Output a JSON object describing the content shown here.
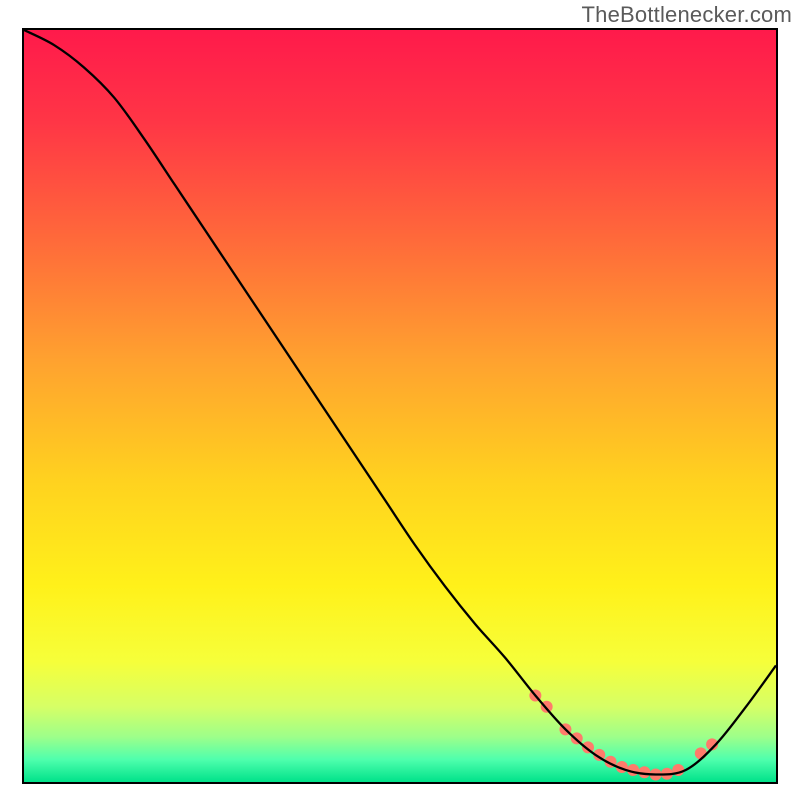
{
  "watermark": "TheBottlenecker.com",
  "chart_data": {
    "type": "line",
    "title": "",
    "xlabel": "",
    "ylabel": "",
    "xlim": [
      0,
      100
    ],
    "ylim": [
      0,
      100
    ],
    "grid": false,
    "legend": false,
    "background_gradient_stops": [
      {
        "offset": 0.0,
        "color": "#ff1a4b"
      },
      {
        "offset": 0.12,
        "color": "#ff3546"
      },
      {
        "offset": 0.28,
        "color": "#ff6a3a"
      },
      {
        "offset": 0.44,
        "color": "#ffa22f"
      },
      {
        "offset": 0.6,
        "color": "#ffd21f"
      },
      {
        "offset": 0.74,
        "color": "#fff11a"
      },
      {
        "offset": 0.84,
        "color": "#f6ff3a"
      },
      {
        "offset": 0.9,
        "color": "#d6ff66"
      },
      {
        "offset": 0.94,
        "color": "#9dff8a"
      },
      {
        "offset": 0.97,
        "color": "#4fffad"
      },
      {
        "offset": 1.0,
        "color": "#00e28a"
      }
    ],
    "series": [
      {
        "name": "bottleneck-curve",
        "color": "#000000",
        "stroke_width": 2.3,
        "x": [
          0,
          4,
          8,
          12,
          16,
          20,
          24,
          28,
          32,
          36,
          40,
          44,
          48,
          52,
          56,
          60,
          64,
          68,
          72,
          76,
          80,
          84,
          88,
          92,
          96,
          100
        ],
        "y": [
          100,
          98,
          95,
          91,
          85.5,
          79.5,
          73.5,
          67.5,
          61.5,
          55.5,
          49.5,
          43.5,
          37.5,
          31.5,
          26,
          21,
          16.5,
          11.5,
          7.0,
          3.6,
          1.6,
          1.0,
          1.6,
          5.0,
          10.0,
          15.5
        ]
      }
    ],
    "markers": {
      "name": "highlight-dots",
      "color": "#ff7b6b",
      "radius": 6,
      "x": [
        68.0,
        69.5,
        72.0,
        73.5,
        75.0,
        76.5,
        78.0,
        79.5,
        81.0,
        82.5,
        84.0,
        85.5,
        87.0,
        90.0,
        91.5
      ],
      "y": [
        11.5,
        10.0,
        7.0,
        5.8,
        4.6,
        3.6,
        2.7,
        2.0,
        1.6,
        1.3,
        1.0,
        1.1,
        1.6,
        3.8,
        5.0
      ]
    }
  }
}
